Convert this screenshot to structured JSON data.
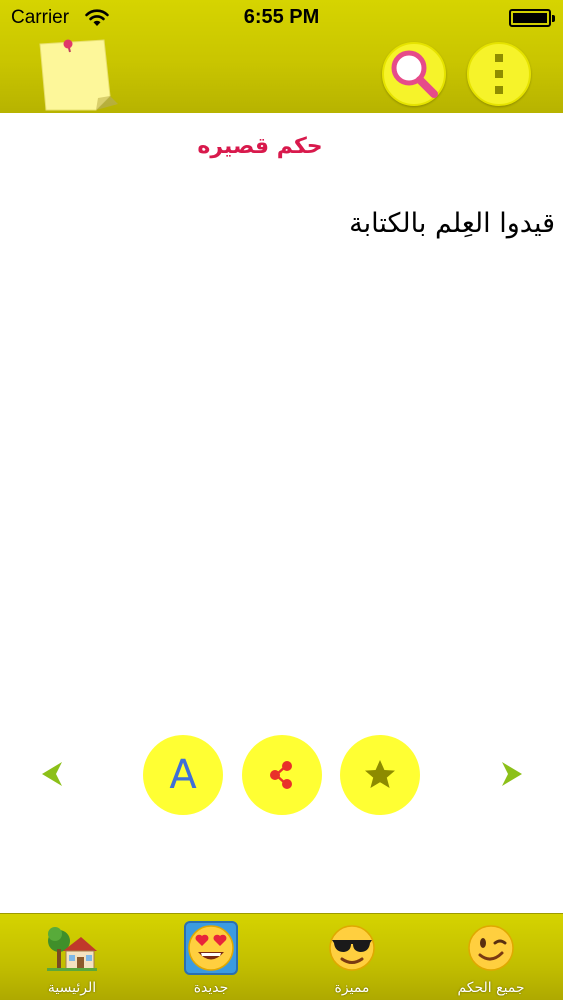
{
  "status_bar": {
    "carrier": "Carrier",
    "time": "6:55 PM"
  },
  "header": {
    "note_icon": "sticky-note-icon",
    "search_icon": "magnifier-icon",
    "menu_icon": "vertical-dots-icon"
  },
  "content": {
    "category_title": "حكم قصيره",
    "quote": "قيدوا العِلم بالكتابة"
  },
  "actions": {
    "font_label": "A",
    "share_icon": "share-icon",
    "favorite_icon": "star-icon",
    "prev_icon": "chevron-left-icon",
    "next_icon": "chevron-right-icon"
  },
  "tabs": [
    {
      "label": "الرئيسية",
      "icon": "house-tree-icon"
    },
    {
      "label": "جديدة",
      "icon": "heart-eyes-emoji-icon",
      "selected": true
    },
    {
      "label": "مميزة",
      "icon": "sunglasses-emoji-icon"
    },
    {
      "label": "جميع الحكم",
      "icon": "winking-emoji-icon"
    }
  ],
  "colors": {
    "header_bg": "#c9c500",
    "button_yellow": "#ffff33",
    "title_red": "#d8194c",
    "arrow_green": "#8cc019",
    "font_blue": "#3f6fd8",
    "share_red": "#e8302a",
    "star_olive": "#8d8b00"
  }
}
